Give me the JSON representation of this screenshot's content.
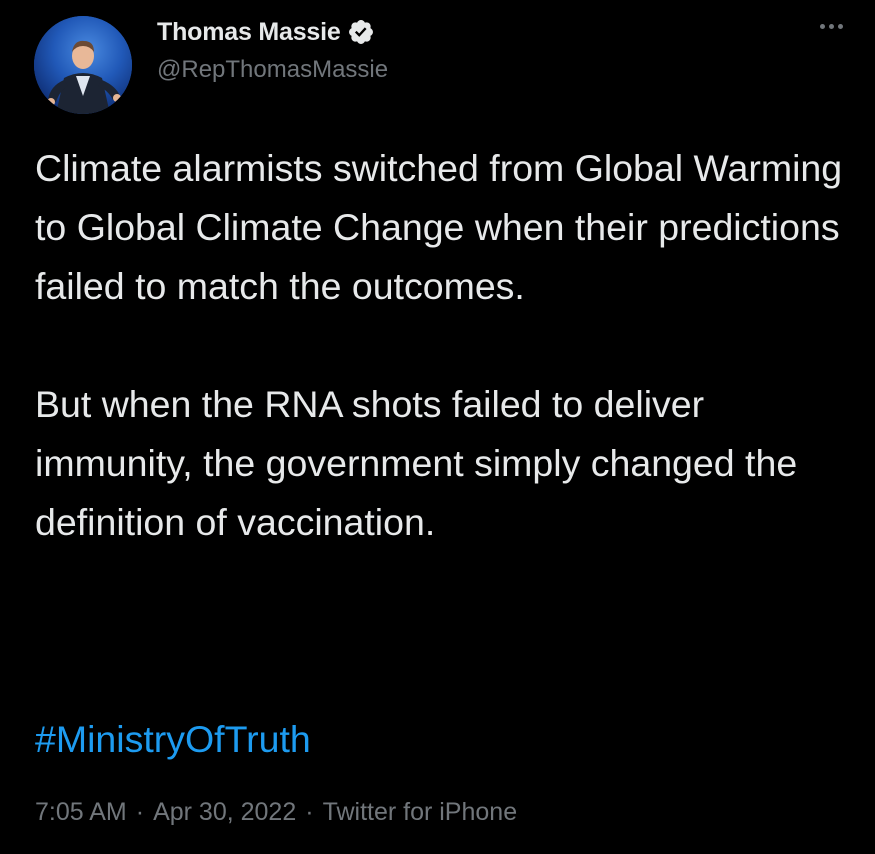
{
  "author": {
    "display_name": "Thomas Massie",
    "handle": "@RepThomasMassie",
    "verified": true,
    "avatar_icon": "profile-photo",
    "verified_icon": "verified-badge-icon"
  },
  "tweet": {
    "paragraph_1": "Climate alarmists switched from Global Warming to Global Climate Change when their predictions failed to match the outcomes.",
    "paragraph_2": "But when the RNA shots failed to deliver immunity, the government simply changed the definition of vaccination.",
    "hashtag": "#MinistryOfTruth"
  },
  "meta": {
    "time": "7:05 AM",
    "separator": "·",
    "date": "Apr 30, 2022",
    "source": "Twitter for iPhone"
  },
  "colors": {
    "background": "#000000",
    "text": "#e7e9ea",
    "secondary": "#71767b",
    "link": "#1d9bf0"
  },
  "more_menu_icon": "more-options-icon"
}
